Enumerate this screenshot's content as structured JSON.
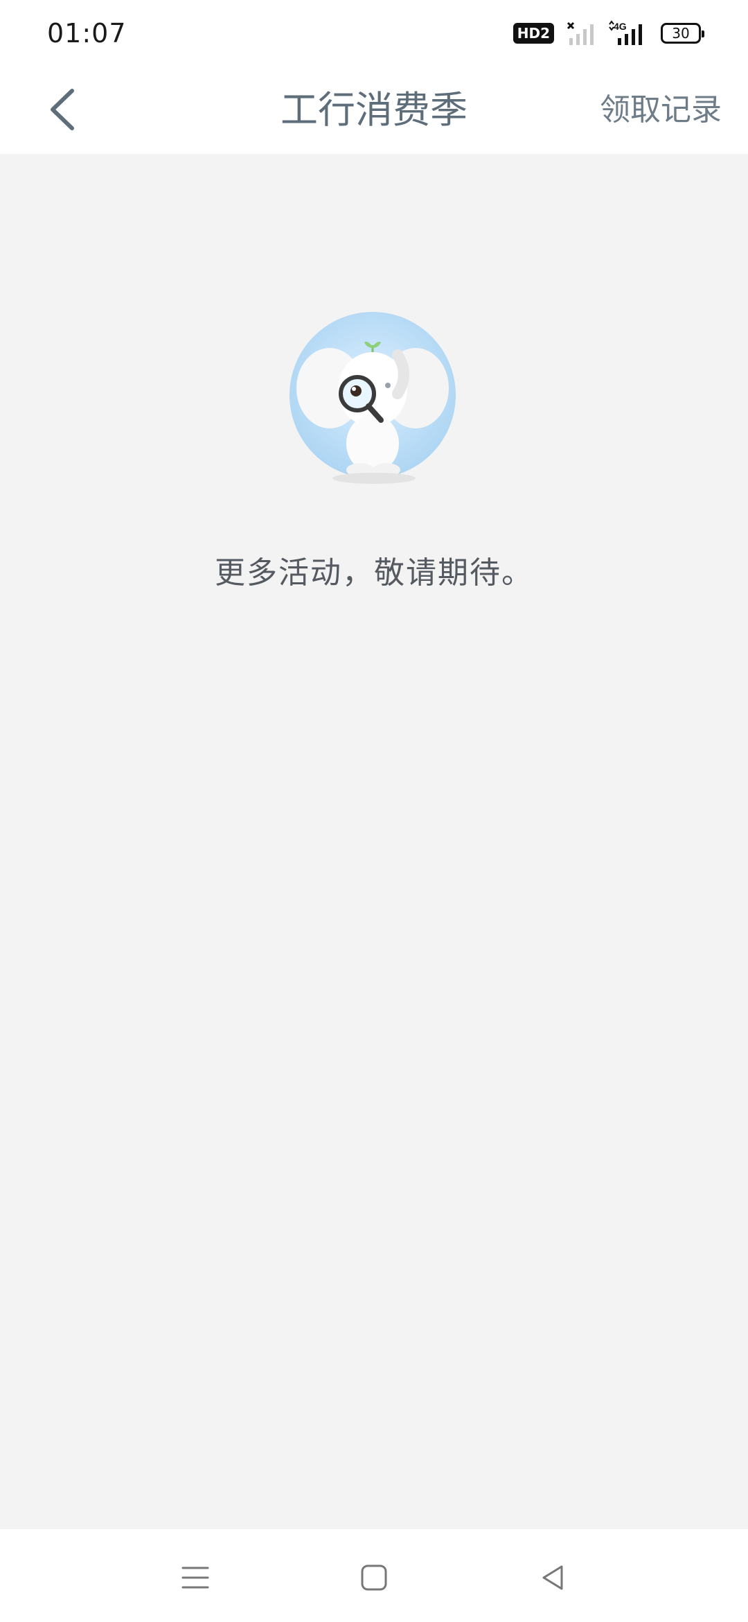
{
  "status_bar": {
    "time": "01:07",
    "hd_label": "HD2",
    "network_label": "4G",
    "battery_level": "30",
    "icons": [
      "hd-icon",
      "no-signal-icon",
      "signal-4g-icon",
      "battery-icon"
    ]
  },
  "nav": {
    "back_icon": "chevron-left-icon",
    "title": "工行消费季",
    "right_action": "领取记录"
  },
  "empty_state": {
    "illustration": "elephant-magnifier-illustration",
    "message": "更多活动，敬请期待。"
  },
  "system_nav": {
    "icons": [
      "menu-icon",
      "home-icon",
      "back-triangle-icon"
    ]
  },
  "colors": {
    "page_background": "#f3f3f4",
    "nav_background": "#ffffff",
    "title_color": "#5d6d7a",
    "text_color": "#555a60",
    "illustration_circle": "#b7dcf5"
  }
}
